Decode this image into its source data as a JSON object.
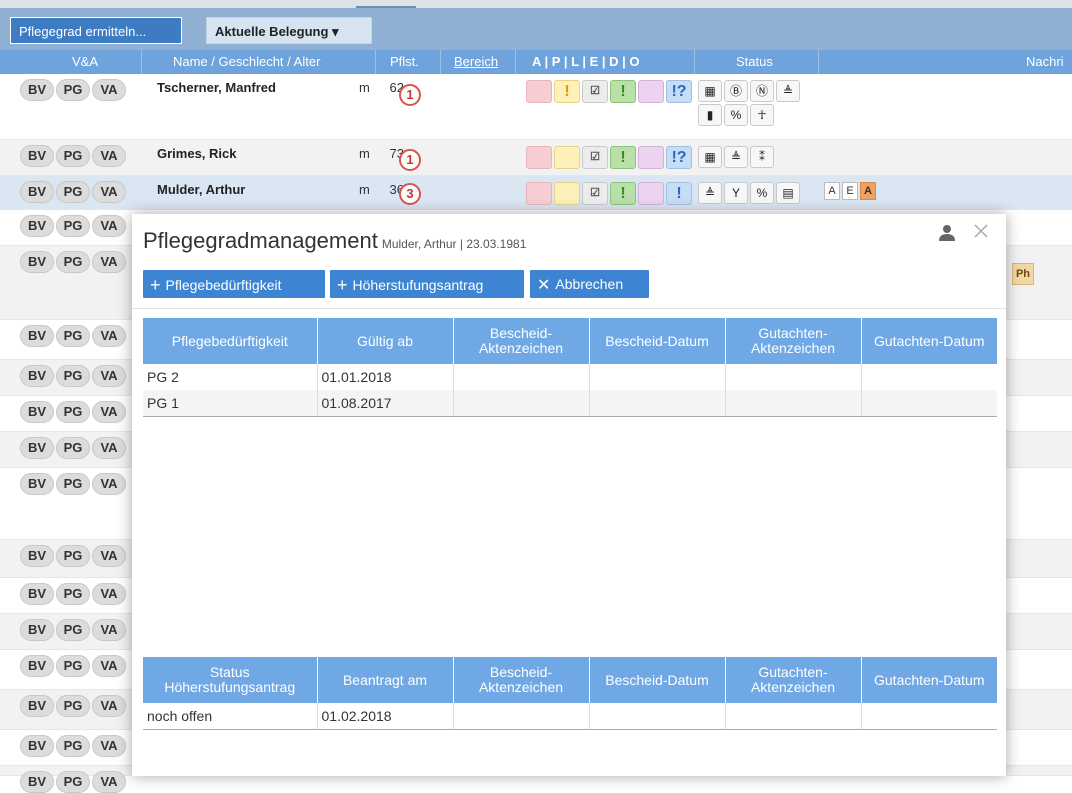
{
  "toolbar": {
    "pflegegrad_button": "Pflegegrad ermitteln...",
    "belegung_button": "Aktuelle Belegung ▾"
  },
  "columns": {
    "va": "V&A",
    "name": "Name / Geschlecht / Alter",
    "pflst": "Pflst.",
    "bereich": "Bereich",
    "apledo": "A | P | L | E | D | O",
    "status": "Status",
    "nachricht": "Nachri"
  },
  "badges": [
    "BV",
    "PG",
    "VA"
  ],
  "patients": [
    {
      "name": "Tscherner, Manfred",
      "sex": "m",
      "age": "62",
      "pflegestufe": "1"
    },
    {
      "name": "Grimes, Rick",
      "sex": "m",
      "age": "73",
      "pflegestufe": "1"
    },
    {
      "name": "Mulder, Arthur",
      "sex": "m",
      "age": "36",
      "pflegestufe": "3"
    }
  ],
  "cell_marks": {
    "yellow": "!",
    "green": "!",
    "blue_q": "!?",
    "blue": "!",
    "gray": "☑"
  },
  "message_boxes": [
    "A",
    "E",
    "A"
  ],
  "ph_badge": "Ph",
  "modal": {
    "title": "Pflegegradmanagement",
    "subtitle": "Mulder, Arthur | 23.03.1981",
    "buttons": {
      "add_pflegebeduerftigkeit": "Pflegebedürftigkeit",
      "add_hoeherstufungsantrag": "Höherstufungsantrag",
      "cancel": "Abbrechen"
    },
    "table1": {
      "headers": [
        "Pflegebedürftigkeit",
        "Gültig ab",
        "Bescheid-\nAktenzeichen",
        "Bescheid-Datum",
        "Gutachten-\nAktenzeichen",
        "Gutachten-Datum"
      ],
      "rows": [
        [
          "PG 2",
          "01.01.2018",
          "",
          "",
          "",
          ""
        ],
        [
          "PG 1",
          "01.08.2017",
          "",
          "",
          "",
          ""
        ]
      ]
    },
    "table2": {
      "headers": [
        "Status\nHöherstufungsantrag",
        "Beantragt am",
        "Bescheid-\nAktenzeichen",
        "Bescheid-Datum",
        "Gutachten-\nAktenzeichen",
        "Gutachten-Datum"
      ],
      "rows": [
        [
          "noch offen",
          "01.02.2018",
          "",
          "",
          "",
          ""
        ]
      ]
    }
  },
  "colors": {
    "header_blue": "#6fa8e5",
    "button_blue": "#3d85d3",
    "toolbar_blue": "#8fb0d2"
  }
}
